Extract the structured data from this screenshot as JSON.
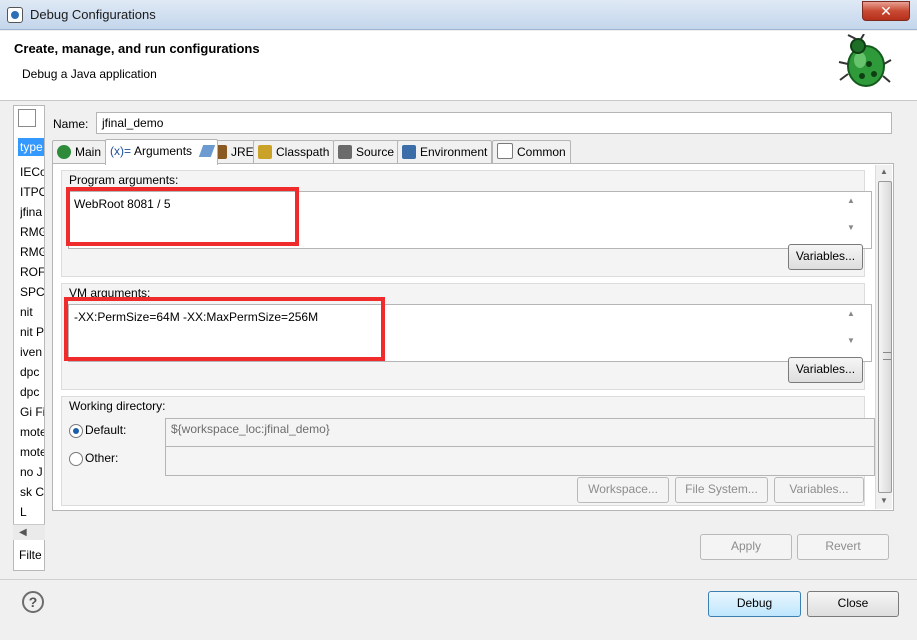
{
  "window": {
    "title": "Debug Configurations",
    "close_glyph": "✕"
  },
  "header": {
    "title": "Create, manage, and run configurations",
    "subtitle": "Debug a Java application"
  },
  "left_panel": {
    "filter_text": "type",
    "items": [
      "IECo",
      "ITPO",
      "jfina",
      "RMG",
      "RMG",
      "ROF",
      "SPC",
      "nit",
      "nit Pl",
      "iven",
      "dpc",
      "dpc",
      "Gi Fi",
      "mote",
      "mote",
      "no J",
      "sk Co",
      "L"
    ],
    "footer": "Filte"
  },
  "name": {
    "label": "Name:",
    "value": "jfinal_demo"
  },
  "tabs": [
    {
      "label": "Main",
      "icon": "main-icon",
      "color": "#2e8b3a"
    },
    {
      "label": "Arguments",
      "icon": "arguments-icon",
      "color": "#1e4f9c",
      "prefix": "(x)="
    },
    {
      "label": "JRE",
      "icon": "jre-icon",
      "color": "#8a5a22"
    },
    {
      "label": "Classpath",
      "icon": "classpath-icon",
      "color": "#c9a227"
    },
    {
      "label": "Source",
      "icon": "source-icon",
      "color": "#6b6b6b"
    },
    {
      "label": "Environment",
      "icon": "environment-icon",
      "color": "#3b6ea8"
    },
    {
      "label": "Common",
      "icon": "common-icon",
      "color": "#7a7a7a"
    }
  ],
  "program_args": {
    "label": "Program arguments:",
    "value": "WebRoot 8081 / 5",
    "variables": "Variables..."
  },
  "vm_args": {
    "label": "VM arguments:",
    "value": "-XX:PermSize=64M -XX:MaxPermSize=256M",
    "variables": "Variables..."
  },
  "working_dir": {
    "label": "Working directory:",
    "default_label": "Default:",
    "default_value": "${workspace_loc:jfinal_demo}",
    "other_label": "Other:",
    "workspace": "Workspace...",
    "file_system": "File System...",
    "variables": "Variables..."
  },
  "actions": {
    "apply": "Apply",
    "revert": "Revert",
    "debug": "Debug",
    "close": "Close"
  },
  "help_glyph": "?",
  "colors": {
    "highlight": "#ef2b2b",
    "selection": "#3399ff"
  }
}
